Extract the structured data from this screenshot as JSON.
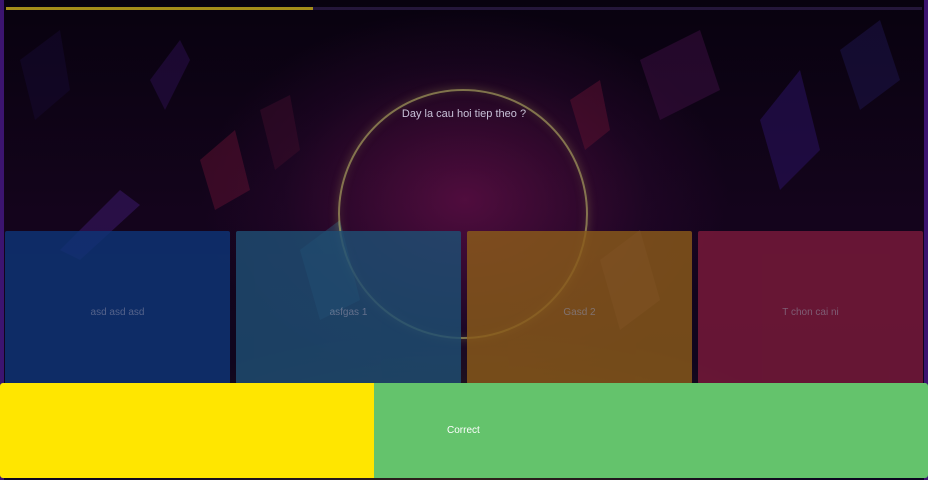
{
  "progress": {
    "fraction": 0.335
  },
  "question": {
    "text": "Day la cau hoi tiep theo ?"
  },
  "answers": [
    {
      "label": "asd asd asd",
      "color": "#0e3576",
      "text_color": "#6d7fa8"
    },
    {
      "label": "asfgas 1",
      "color": "#1f4e73",
      "text_color": "#7d8ea8"
    },
    {
      "label": "Gasd 2",
      "color": "#8a5a1a",
      "text_color": "#9a8f8a"
    },
    {
      "label": "T chon cai ni",
      "color": "#7a1a3a",
      "text_color": "#9a7a90"
    }
  ],
  "result": {
    "label": "Correct",
    "left_color": "#ffe600",
    "right_color": "#64c36c"
  }
}
